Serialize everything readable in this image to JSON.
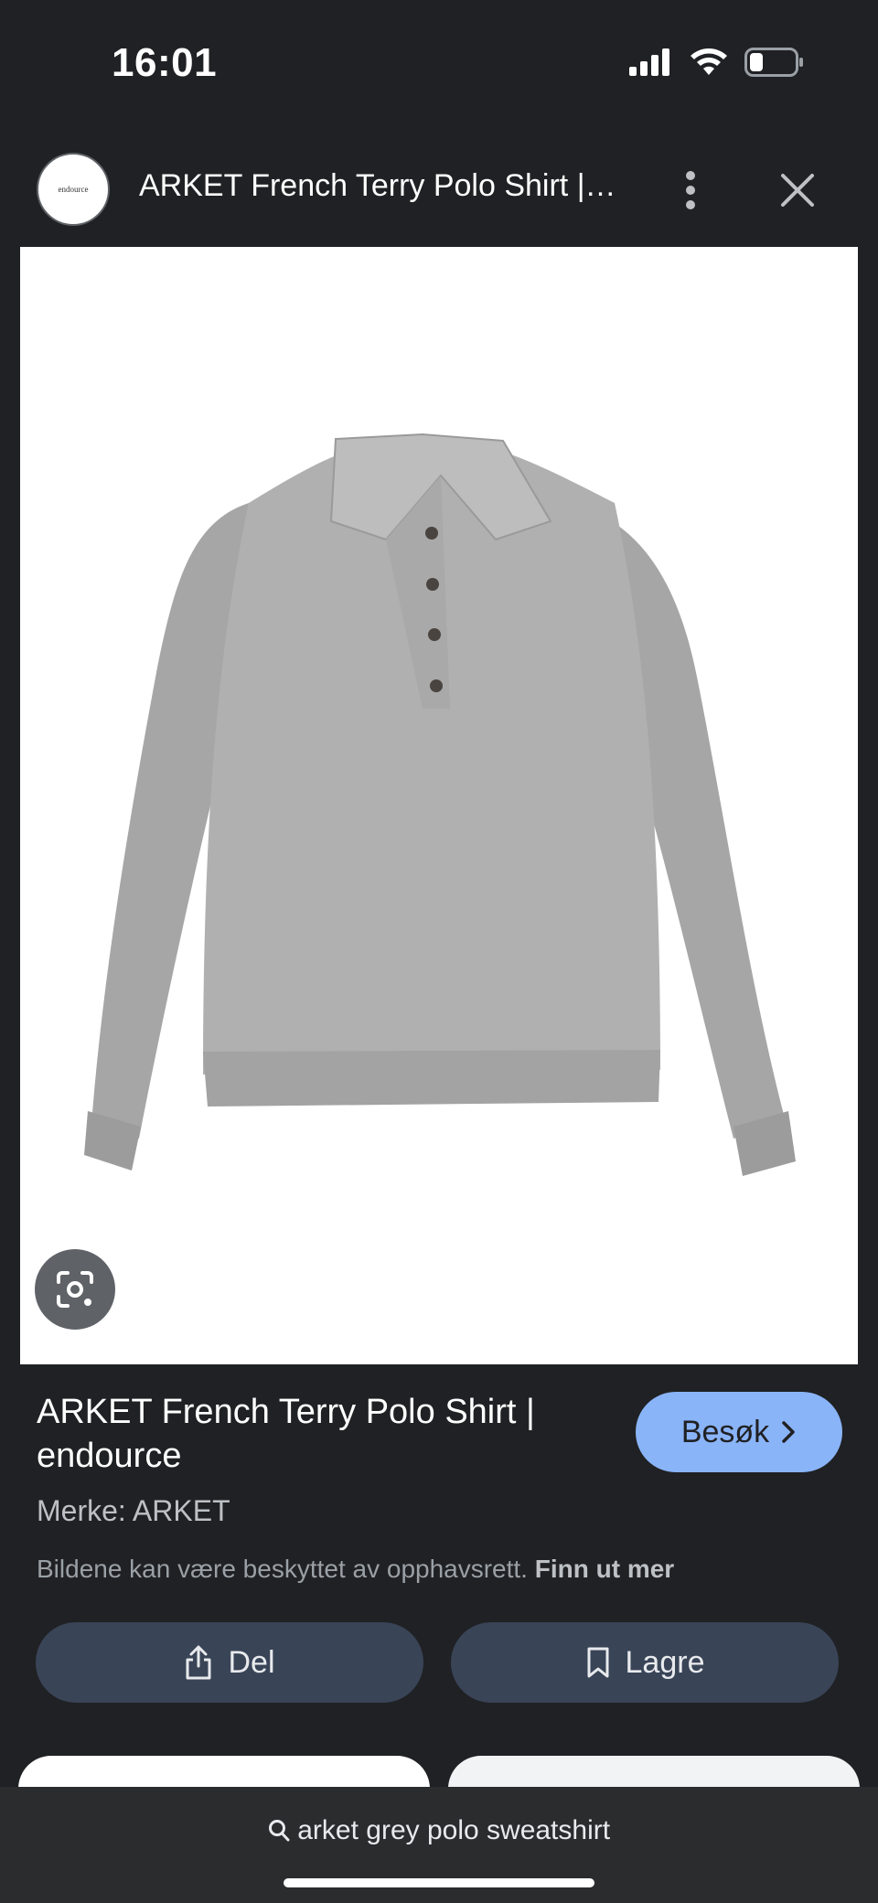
{
  "status_bar": {
    "time": "16:01"
  },
  "header": {
    "site_logo_text": "endource",
    "title": "ARKET French Terry Polo Shirt | endource",
    "more_icon": "more-vert-icon",
    "close_icon": "close-icon"
  },
  "image": {
    "lens_icon": "lens-icon"
  },
  "result": {
    "title": "ARKET French Terry Polo Shirt | endource",
    "visit_label": "Besøk",
    "brand": "Merke: ARKET",
    "copyright_text": "Bildene kan være beskyttet av opphavsrett.",
    "learn_more": "Finn ut mer"
  },
  "actions": {
    "share_label": "Del",
    "save_label": "Lagre"
  },
  "search": {
    "query": "arket grey polo sweatshirt"
  },
  "colors": {
    "background": "#202124",
    "accent": "#8ab4f8",
    "action_button": "#394457"
  }
}
